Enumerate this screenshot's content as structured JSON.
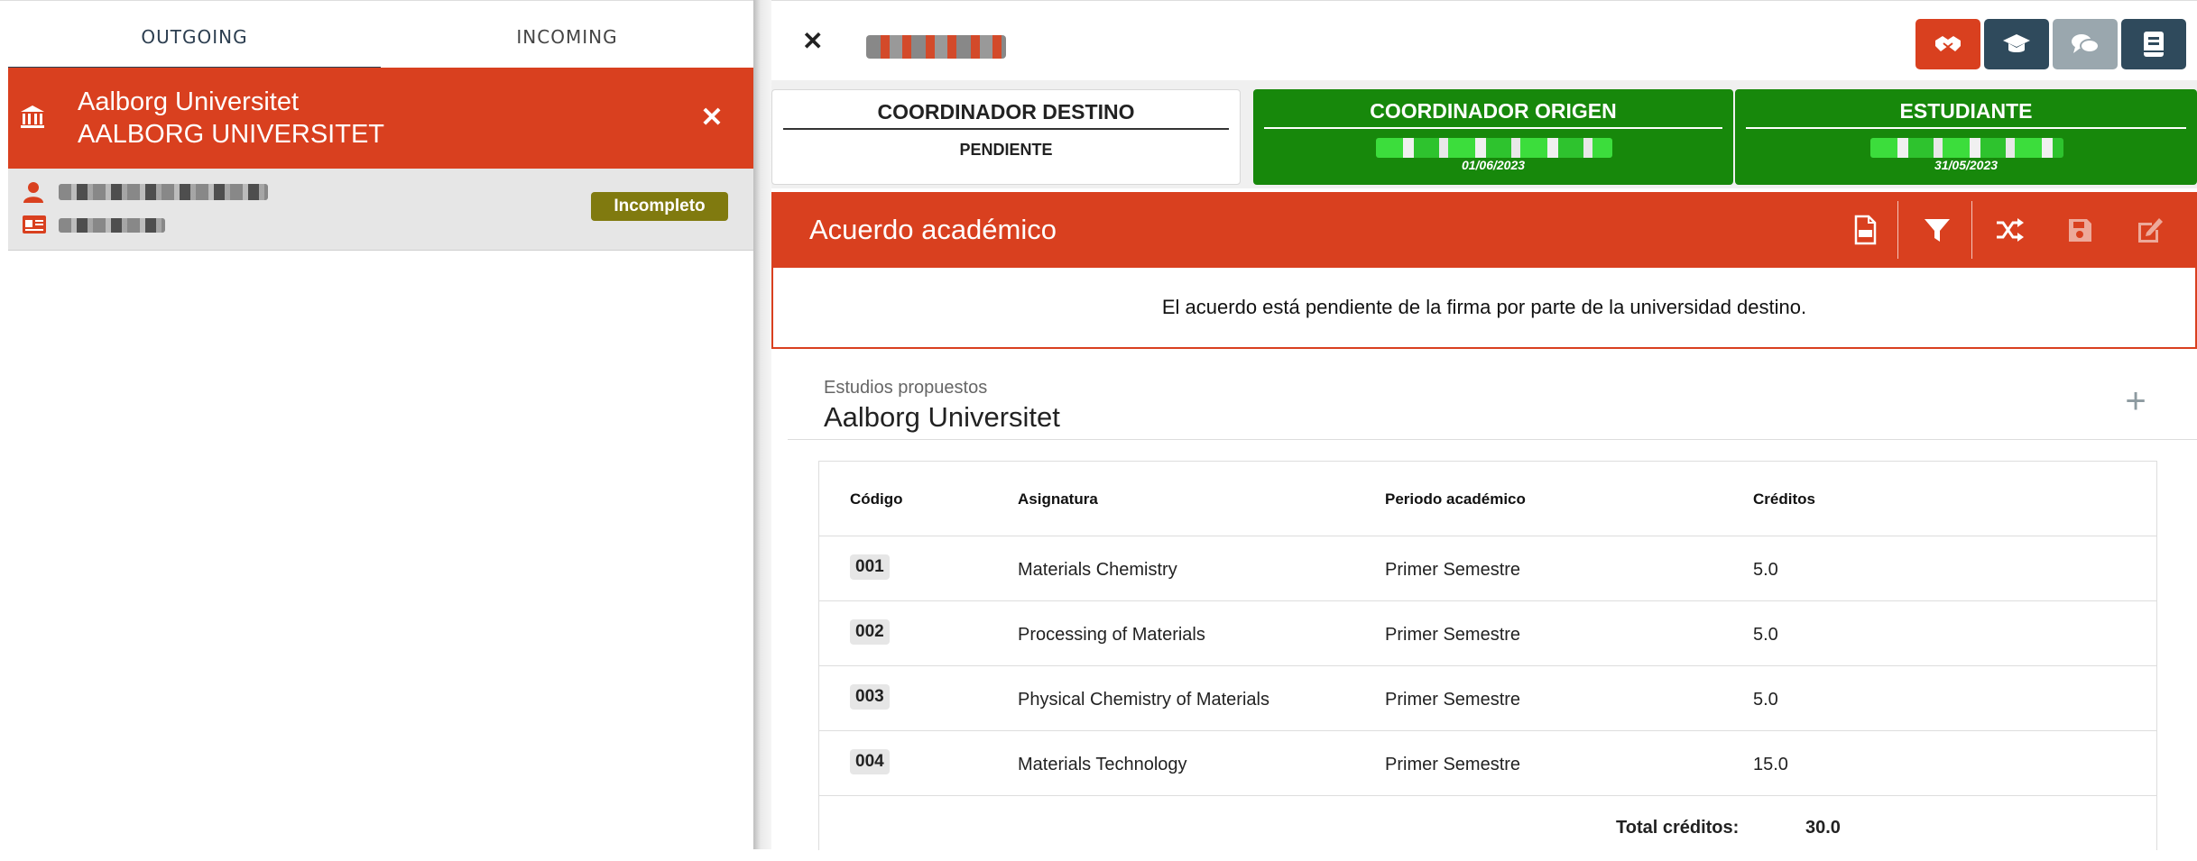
{
  "tabs": {
    "outgoing": "OUTGOING",
    "incoming": "INCOMING"
  },
  "sidebar": {
    "university": {
      "name": "Aalborg Universitet",
      "name_upper": "AALBORG UNIVERSITET"
    },
    "student": {
      "status_badge": "Incompleto"
    }
  },
  "cards": {
    "destino": {
      "title": "COORDINADOR DESTINO",
      "status": "PENDIENTE"
    },
    "origen": {
      "title": "COORDINADOR ORIGEN",
      "date": "01/06/2023"
    },
    "estudiante": {
      "title": "ESTUDIANTE",
      "date": "31/05/2023"
    }
  },
  "acuerdo": {
    "title": "Acuerdo académico",
    "notice": "El acuerdo está pendiente de la firma por parte de la universidad destino."
  },
  "studies": {
    "label": "Estudios propuestos",
    "university": "Aalborg Universitet",
    "columns": {
      "code": "Código",
      "subject": "Asignatura",
      "period": "Periodo académico",
      "credits": "Créditos"
    },
    "rows": [
      {
        "code": "001",
        "subject": "Materials Chemistry",
        "period": "Primer Semestre",
        "credits": "5.0"
      },
      {
        "code": "002",
        "subject": "Processing of Materials",
        "period": "Primer Semestre",
        "credits": "5.0"
      },
      {
        "code": "003",
        "subject": "Physical Chemistry of Materials",
        "period": "Primer Semestre",
        "credits": "5.0"
      },
      {
        "code": "004",
        "subject": "Materials Technology",
        "period": "Primer Semestre",
        "credits": "15.0"
      }
    ],
    "total_label": "Total créditos:",
    "total_value": "30.0"
  },
  "colors": {
    "accent": "#d9401f",
    "dark": "#2f4a5c",
    "success": "#17880b",
    "badge": "#807a0f"
  },
  "icons": [
    "bank-icon",
    "user-icon",
    "id-card-icon",
    "close-icon",
    "handshake-icon",
    "graduation-cap-icon",
    "chat-icon",
    "book-icon",
    "pdf-icon",
    "filter-icon",
    "shuffle-icon",
    "save-icon",
    "edit-icon",
    "plus-icon"
  ]
}
